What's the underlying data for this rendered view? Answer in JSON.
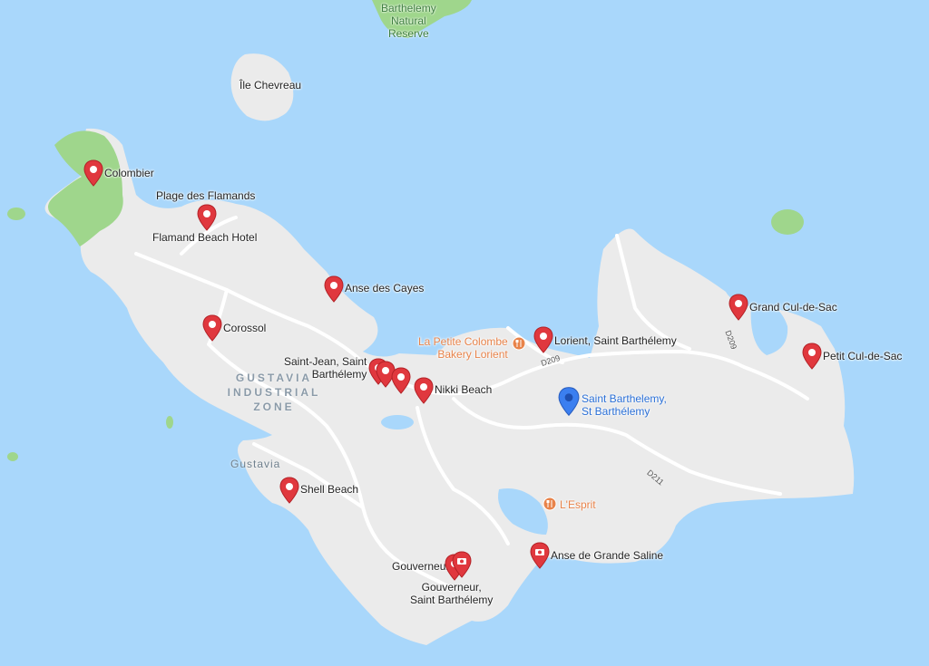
{
  "colors": {
    "water": "#a9d7fb",
    "land": "#ebebeb",
    "park": "#9fd68c",
    "road": "#ffffff",
    "pin": "#e0383e",
    "pin_selected": "#3b7ff0",
    "restaurant": "#e8834a"
  },
  "islands": {
    "nature_reserve": {
      "line1": "Barthelemy",
      "line2": "Natural",
      "line3": "Reserve"
    },
    "chevreau": "Île Chevreau"
  },
  "zone": {
    "line1": "GUSTAVIA",
    "line2": "INDUSTRIAL",
    "line3": "ZONE"
  },
  "town": "Gustavia",
  "roads": {
    "d209a": "D209",
    "d209b": "D209",
    "d211": "D211"
  },
  "places": {
    "colombier": "Colombier",
    "flamands_beach": "Plage des Flamands",
    "flamand_hotel": "Flamand Beach Hotel",
    "anse_cayes": "Anse des Cayes",
    "corossol": "Corossol",
    "saint_jean_l1": "Saint-Jean, Saint",
    "saint_jean_l2": "Barthélemy",
    "nikki": "Nikki Beach",
    "lorient": "Lorient, Saint Barthélemy",
    "petite_colombe_l1": "La Petite Colombe",
    "petite_colombe_l2": "Bakery Lorient",
    "st_barth_l1": "Saint Barthelemy,",
    "st_barth_l2": "St Barthélemy",
    "grand_cul": "Grand Cul-de-Sac",
    "petit_cul": "Petit Cul-de-Sac",
    "shell": "Shell Beach",
    "lesprit": "L'Esprit",
    "grande_saline": "Anse de Grande Saline",
    "gouverneur": "Gouverneur",
    "gouverneur_sb_l1": "Gouverneur,",
    "gouverneur_sb_l2": "Saint Barthélemy"
  }
}
